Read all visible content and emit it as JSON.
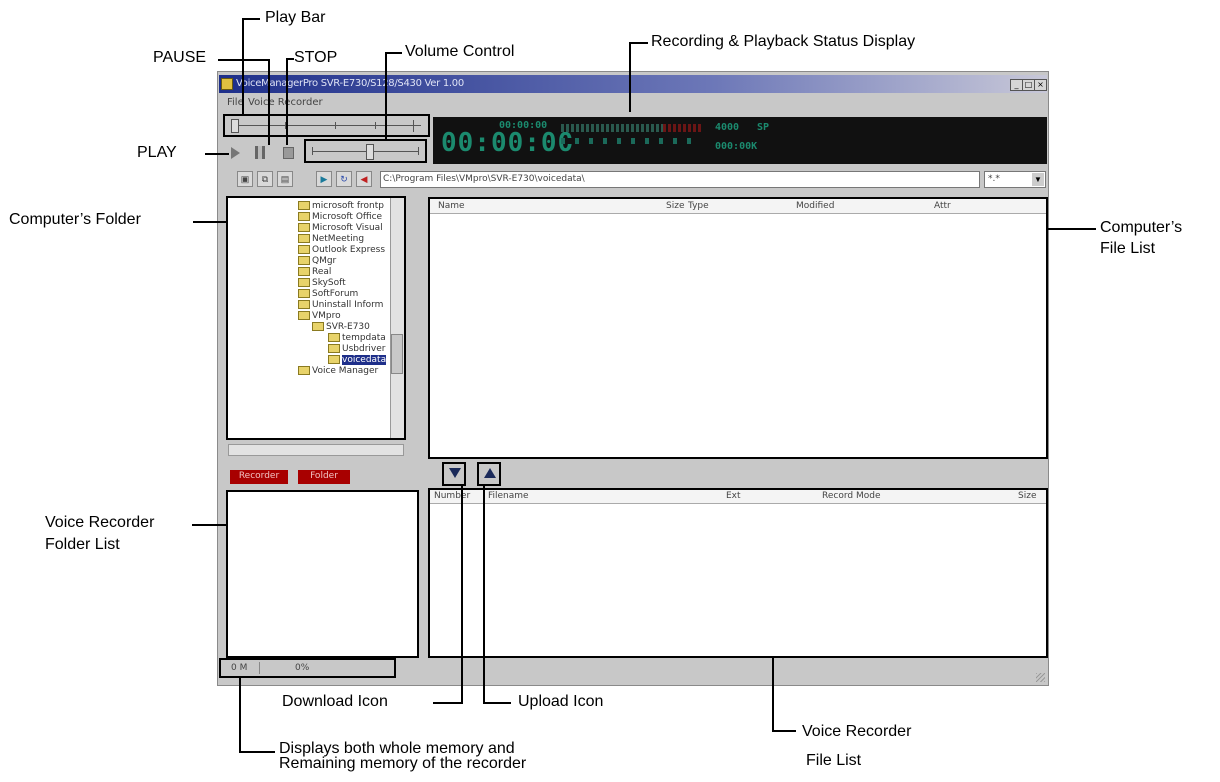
{
  "callouts": {
    "play_bar": "Play Bar",
    "pause": "PAUSE",
    "stop": "STOP",
    "volume_control": "Volume Control",
    "status_display": "Recording & Playback Status Display",
    "play": "PLAY",
    "computers_folder": "Computer’s Folder",
    "computers_file_list_1": "Computer’s",
    "computers_file_list_2": "File List",
    "vr_folder_list_1": "Voice Recorder",
    "vr_folder_list_2": "Folder List",
    "download_icon": "Download Icon",
    "upload_icon": "Upload Icon",
    "vr_file_list_1": "Voice Recorder",
    "vr_file_list_2": "File List",
    "memory_1": "Displays both whole memory and",
    "memory_2": "Remaining memory of the recorder"
  },
  "window": {
    "title": "VoiceManagerPro SVR-E730/S128/S430 Ver 1.00",
    "menu": [
      "File",
      "Voice Recorder"
    ],
    "lcd": {
      "big_time": "00:00:00",
      "small_time": "00:00:00",
      "rate": "4000",
      "mode": "SP",
      "counter": "000:00K"
    },
    "path": "C:\\Program Files\\VMpro\\SVR-E730\\voicedata\\",
    "filter": "*.*",
    "file_list_headers": [
      "Name",
      "Size",
      "Type",
      "Modified",
      "Attr"
    ],
    "tree_items": [
      "microsoft frontp",
      "Microsoft Office",
      "Microsoft Visual",
      "NetMeeting",
      "Outlook Express",
      "QMgr",
      "Real",
      "SkySoft",
      "SoftForum",
      "Uninstall Inform",
      "VMpro",
      "SVR-E730",
      "tempdata",
      "Usbdriver",
      "voicedata",
      "Voice Manager"
    ],
    "recorder_button": "Recorder",
    "folder_button": "Folder",
    "vr_headers": [
      "Number",
      "Filename",
      "Ext",
      "Record Mode",
      "Size"
    ],
    "status_memory": "0 M",
    "status_percent": "0%"
  },
  "colors": {
    "title_bar": "#1e2f8a",
    "lcd_bg": "#111111",
    "lcd_text": "#1b8a6e",
    "red_button": "#a80000"
  }
}
